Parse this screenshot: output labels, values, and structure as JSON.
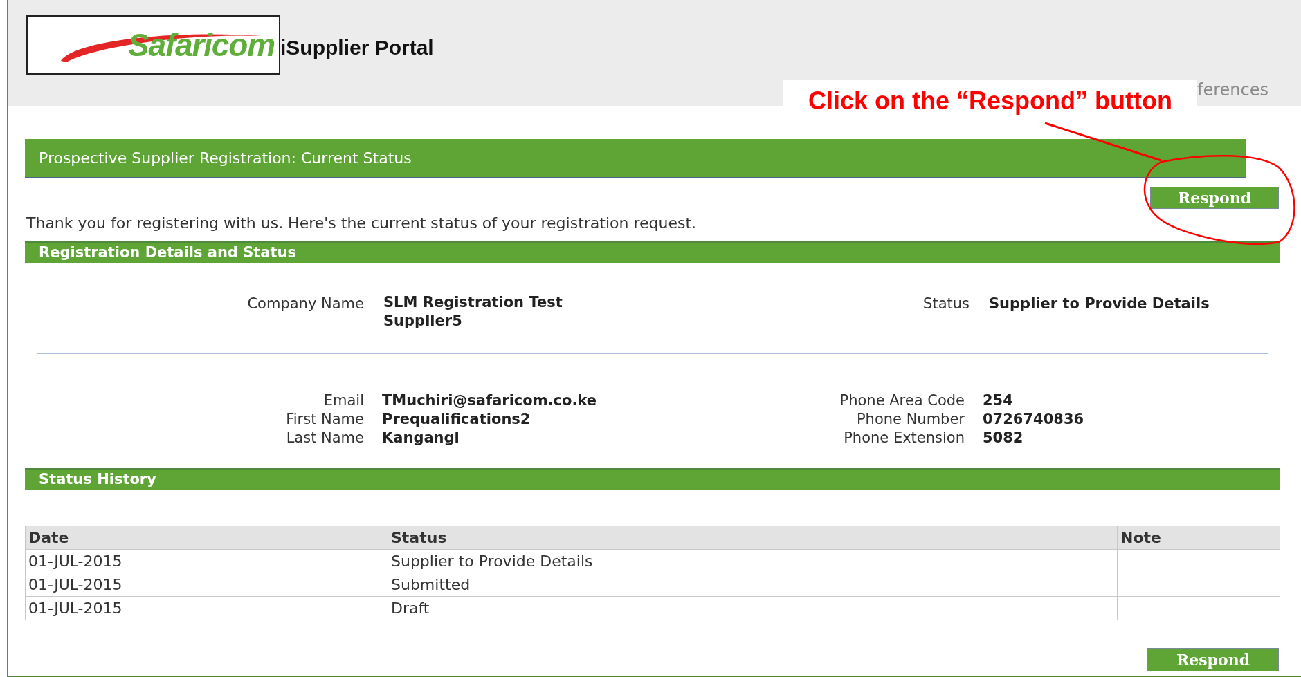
{
  "header": {
    "logo": "Safaricom",
    "title": "iSupplier Portal",
    "menu_fragment": "ferences"
  },
  "callout": {
    "text": "Click on the “Respond” button"
  },
  "page_title": "Prospective Supplier Registration: Current Status",
  "top_button": {
    "label": "Respond"
  },
  "intro": "Thank you for registering with us. Here's the current status of your registration request.",
  "details": {
    "title": "Registration Details and Status",
    "company": {
      "label": "Company Name",
      "value": "SLM Registration Test Supplier5"
    },
    "status": {
      "label": "Status",
      "value": "Supplier to Provide Details"
    },
    "left_fields": [
      {
        "label": "Email",
        "value": "TMuchiri@safaricom.co.ke"
      },
      {
        "label": "First Name",
        "value": "Prequalifications2"
      },
      {
        "label": "Last Name",
        "value": "Kangangi"
      }
    ],
    "right_fields": [
      {
        "label": "Phone Area Code",
        "value": "254"
      },
      {
        "label": "Phone Number",
        "value": "0726740836"
      },
      {
        "label": "Phone Extension",
        "value": "5082"
      }
    ]
  },
  "status_history": {
    "title": "Status History",
    "columns": [
      "Date",
      "Status",
      "Note"
    ],
    "rows": [
      {
        "date": "01-JUL-2015",
        "status": "Supplier to Provide Details"
      },
      {
        "date": "01-JUL-2015",
        "status": "Submitted"
      },
      {
        "date": "01-JUL-2015",
        "status": "Draft"
      }
    ]
  },
  "bottom_button": {
    "label": "Respond"
  }
}
